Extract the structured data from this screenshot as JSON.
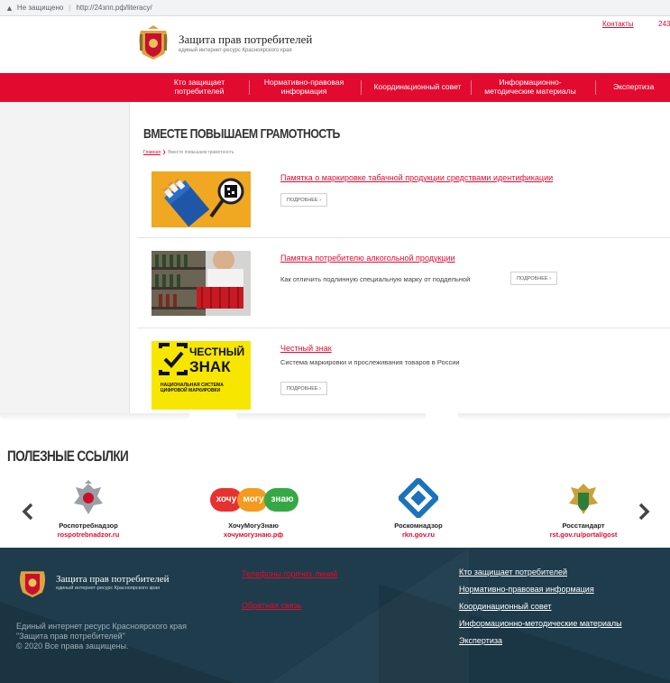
{
  "browser": {
    "security_label": "Не защищено",
    "url": "http://24зпп.рф/literacy/"
  },
  "header": {
    "logo_title": "Защита прав потребителей",
    "logo_subtitle": "единый интернет-ресурс Красноярского края",
    "top_link_contacts": "Контакты",
    "top_link_phone": "243"
  },
  "nav": {
    "items": [
      {
        "label": "Кто защищает потребителей"
      },
      {
        "label": "Нормативно-правовая информация"
      },
      {
        "label": "Координационный совет"
      },
      {
        "label": "Информационно-методические материалы"
      },
      {
        "label": "Экспертиза"
      }
    ]
  },
  "page": {
    "title": "ВМЕСТЕ ПОВЫШАЕМ ГРАМОТНОСТЬ",
    "breadcrumb_home": "Главная",
    "breadcrumb_current": "Вместе повышаем грамотность"
  },
  "articles": [
    {
      "title": "Памятка о маркировке табачной продукции средствами идентификации",
      "description": "",
      "button": "ПОДРОБНЕЕ ›"
    },
    {
      "title": "Памятка потребителю алкогольной продукции",
      "description": "Как отличить подлинную специальную марку от поддельной",
      "button": "ПОДРОБНЕЕ ›"
    },
    {
      "title": "Честный знак",
      "description": "Система маркировки и прослеживания товаров в России",
      "button": "ПОДРОБНЕЕ ›"
    }
  ],
  "znak_logo": {
    "line1": "ЧЕСТНЫЙ",
    "line2": "ЗНАК",
    "line3": "НАЦИОНАЛЬНАЯ СИСТЕМА ЦИФРОВОЙ МАРКИРОВКИ"
  },
  "useful_links": {
    "title": "ПОЛЕЗНЫЕ ССЫЛКИ",
    "items": [
      {
        "name": "Роспотребнадзор",
        "url": "rospotrebnadzor.ru"
      },
      {
        "name": "ХочуМогуЗнаю",
        "url": "хочумогузнаю.рф"
      },
      {
        "name": "Роскомнадзор",
        "url": "rkn.gov.ru"
      },
      {
        "name": "Росстандарт",
        "url": "rst.gov.ru/portal/gost"
      }
    ],
    "hmz_words": [
      "хочу",
      "могу",
      "знаю"
    ]
  },
  "footer": {
    "logo_title": "Защита прав потребителей",
    "logo_subtitle": "единый интернет-ресурс Красноярского края",
    "copyright_line1": "Единый интернет ресурс Красноярского края",
    "copyright_line2": "\"Защита прав потребителей\"",
    "copyright_line3": "© 2020 Все права защищены.",
    "hotlines": "Телефоны горячих линий",
    "feedback": "Обратная связь",
    "links": [
      "Кто защищает потребителей",
      "Нормативно-правовая информация",
      "Координационный совет",
      "Информационно-методические материалы",
      "Экспертиза"
    ]
  },
  "colors": {
    "brand_red": "#e30a30",
    "footer_bg": "#1e3c4c",
    "znak_yellow": "#f7e600"
  }
}
